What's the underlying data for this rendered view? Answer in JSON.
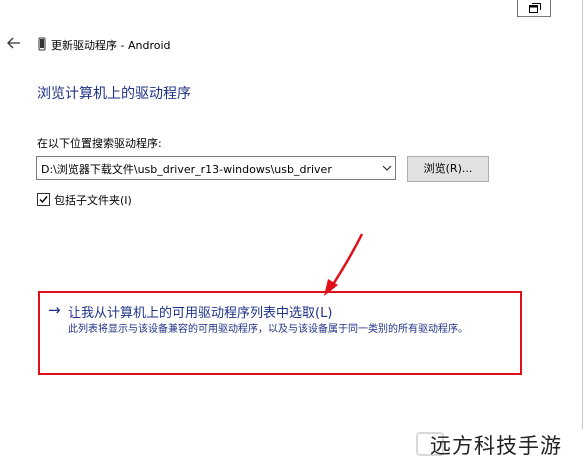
{
  "window": {
    "title": "更新驱动程序 - Android"
  },
  "page": {
    "heading": "浏览计算机上的驱动程序",
    "search_label": "在以下位置搜索驱动程序:",
    "path_value": "D:\\浏览器下载文件\\usb_driver_r13-windows\\usb_driver",
    "browse_label": "浏览(R)...",
    "include_subfolders_label": "包括子文件夹(I)",
    "include_subfolders_checked": true
  },
  "option": {
    "arrow": "→",
    "title": "让我从计算机上的可用驱动程序列表中选取(L)",
    "description": "此列表将显示与该设备兼容的可用驱动程序，以及与该设备属于同一类别的所有驱动程序。"
  },
  "watermark": {
    "text": "远方科技手游"
  },
  "colors": {
    "link_blue": "#1e3287",
    "highlight_red": "#e0101a"
  }
}
